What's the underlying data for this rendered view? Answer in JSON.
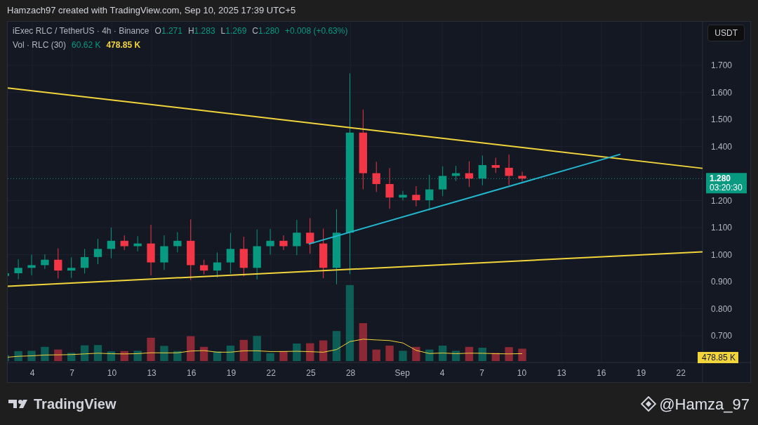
{
  "header": {
    "credit": "Hamzach97 created with TradingView.com, Sep 10, 2025 17:39 UTC+5"
  },
  "legend": {
    "symbol": "iExec RLC / TetherUS · 4h · Binance",
    "ohlc": [
      {
        "label": "O",
        "value": "1.271"
      },
      {
        "label": "H",
        "value": "1.283"
      },
      {
        "label": "L",
        "value": "1.269"
      },
      {
        "label": "C",
        "value": "1.280"
      }
    ],
    "change": "+0.008 (+0.63%)",
    "volume_label": "Vol · RLC (30)",
    "volume_value": "60.62 K",
    "volume_ma": "478.85 K"
  },
  "currency_button": "USDT",
  "chart": {
    "price_axis_labels": [
      "1.700",
      "1.600",
      "1.500",
      "1.400",
      "1.200",
      "1.100",
      "1.000",
      "0.900",
      "0.800",
      "0.700"
    ],
    "time_axis_labels": [
      "4",
      "7",
      "10",
      "13",
      "16",
      "19",
      "22",
      "25",
      "28",
      "Sep",
      "4",
      "7",
      "10",
      "13",
      "16",
      "19",
      "22"
    ],
    "price_badge": {
      "price": "1.280",
      "countdown": "03:20:30"
    },
    "volume_badge": "478.85 K"
  },
  "footer": {
    "brand": "TradingView",
    "author": "@Hamza_97"
  }
}
